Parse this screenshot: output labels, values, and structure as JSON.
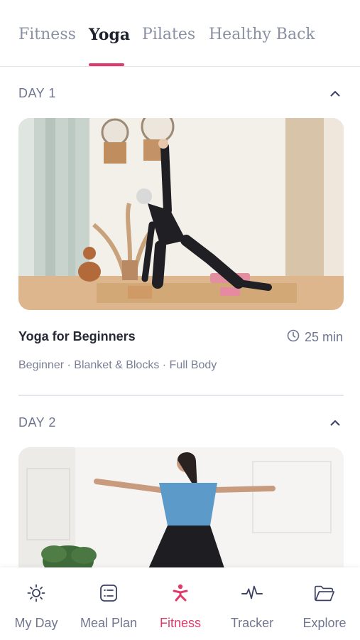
{
  "tabs": [
    {
      "label": "Fitness",
      "active": false
    },
    {
      "label": "Yoga",
      "active": true
    },
    {
      "label": "Pilates",
      "active": false
    },
    {
      "label": "Healthy Back",
      "active": false
    }
  ],
  "days": [
    {
      "label": "DAY 1",
      "expanded": true,
      "workout": {
        "title": "Yoga for Beginners",
        "duration": "25 min",
        "tags": "Beginner · Blanket & Blocks · Full Body"
      }
    },
    {
      "label": "DAY 2",
      "expanded": true
    }
  ],
  "bottom_nav": [
    {
      "label": "My Day",
      "icon": "sun-icon"
    },
    {
      "label": "Meal Plan",
      "icon": "meal-plan-icon"
    },
    {
      "label": "Fitness",
      "icon": "fitness-person-icon",
      "active": true
    },
    {
      "label": "Tracker",
      "icon": "pulse-icon"
    },
    {
      "label": "Explore",
      "icon": "folder-icon"
    }
  ],
  "colors": {
    "accent": "#e03a6c",
    "muted": "#717690",
    "heading": "#262a36"
  }
}
